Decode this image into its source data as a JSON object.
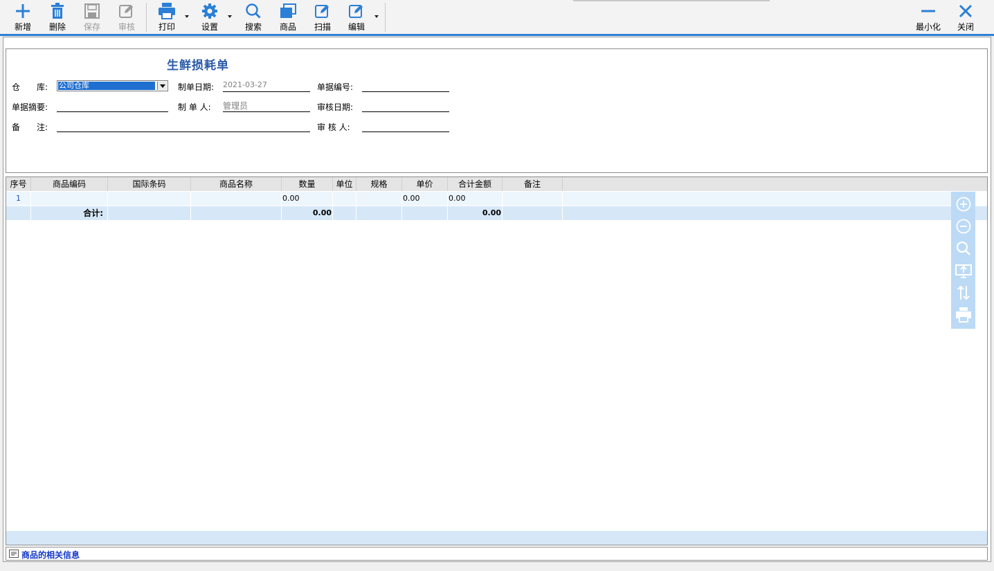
{
  "toolbar": {
    "add_label": "新增",
    "delete_label": "删除",
    "save_label": "保存",
    "audit_label": "审核",
    "print_label": "打印",
    "settings_label": "设置",
    "search_label": "搜索",
    "goods_label": "商品",
    "scan_label": "扫描",
    "edit_label": "编辑",
    "minimize_label": "最小化",
    "close_label": "关闭"
  },
  "form": {
    "title": "生鲜损耗单",
    "warehouse_label": "仓　　库:",
    "warehouse_value": "公司仓库",
    "date_label": "制单日期:",
    "date_value": "2021-03-27",
    "doc_no_label": "单据编号:",
    "doc_no_value": "",
    "summary_label": "单据摘要:",
    "summary_value": "",
    "creator_label": "制 单 人:",
    "creator_value": "管理员",
    "audit_date_label": "审核日期:",
    "audit_date_value": "",
    "remark_label": "备　　注:",
    "remark_value": "",
    "auditor_label": "审 核 人:",
    "auditor_value": ""
  },
  "grid": {
    "columns": [
      "序号",
      "商品编码",
      "国际条码",
      "商品名称",
      "数量",
      "单位",
      "规格",
      "单价",
      "合计金额",
      "备注"
    ],
    "row": {
      "index": "1",
      "qty": "0.00",
      "price": "0.00",
      "amount": "0.00"
    },
    "total": {
      "label": "合计:",
      "qty": "0.00",
      "amount": "0.00"
    }
  },
  "side_tools": [
    "zoom-in-icon",
    "zoom-out-icon",
    "search-icon",
    "export-icon",
    "sort-icon",
    "print-icon"
  ],
  "footer": {
    "label": "商品的相关信息"
  },
  "colors": {
    "accent": "#2b7fd6",
    "title": "#2a5aa8",
    "footer_text": "#1438c8",
    "row_highlight": "#d6e8f8"
  }
}
